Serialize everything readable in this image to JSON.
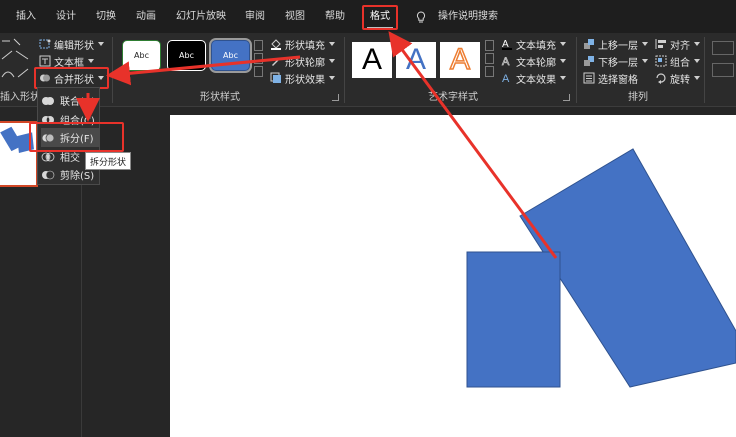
{
  "tabs": [
    {
      "label": "插入"
    },
    {
      "label": "设计"
    },
    {
      "label": "切换"
    },
    {
      "label": "动画"
    },
    {
      "label": "幻灯片放映"
    },
    {
      "label": "审阅"
    },
    {
      "label": "视图"
    },
    {
      "label": "帮助"
    },
    {
      "label": "格式",
      "active": true
    }
  ],
  "tell_me": "操作说明搜索",
  "insert_shapes": {
    "edit_shape": "编辑形状",
    "text_box": "文本框",
    "merge_shapes": "合并形状",
    "group_label": "插入形状"
  },
  "shape_styles": {
    "samples": [
      "Abc",
      "Abc",
      "Abc"
    ],
    "shape_fill": "形状填充",
    "shape_outline": "形状轮廓",
    "shape_effects": "形状效果",
    "group_label": "形状样式"
  },
  "wordart": {
    "letters": [
      "A",
      "A",
      "A"
    ],
    "text_fill": "文本填充",
    "text_outline": "文本轮廓",
    "text_effects": "文本效果",
    "group_label": "艺术字样式"
  },
  "arrange": {
    "bring_forward": "上移一层",
    "send_backward": "下移一层",
    "selection_pane": "选择窗格",
    "align": "对齐",
    "group": "组合",
    "rotate": "旋转",
    "group_label": "排列"
  },
  "merge_menu": {
    "items": [
      "联合(U)",
      "组合(C)",
      "拆分(F)",
      "相交",
      "剪除(S)"
    ],
    "tooltip": "拆分形状"
  },
  "colors": {
    "shape_fill": "#4472c4",
    "highlight_red": "#e8322a"
  }
}
